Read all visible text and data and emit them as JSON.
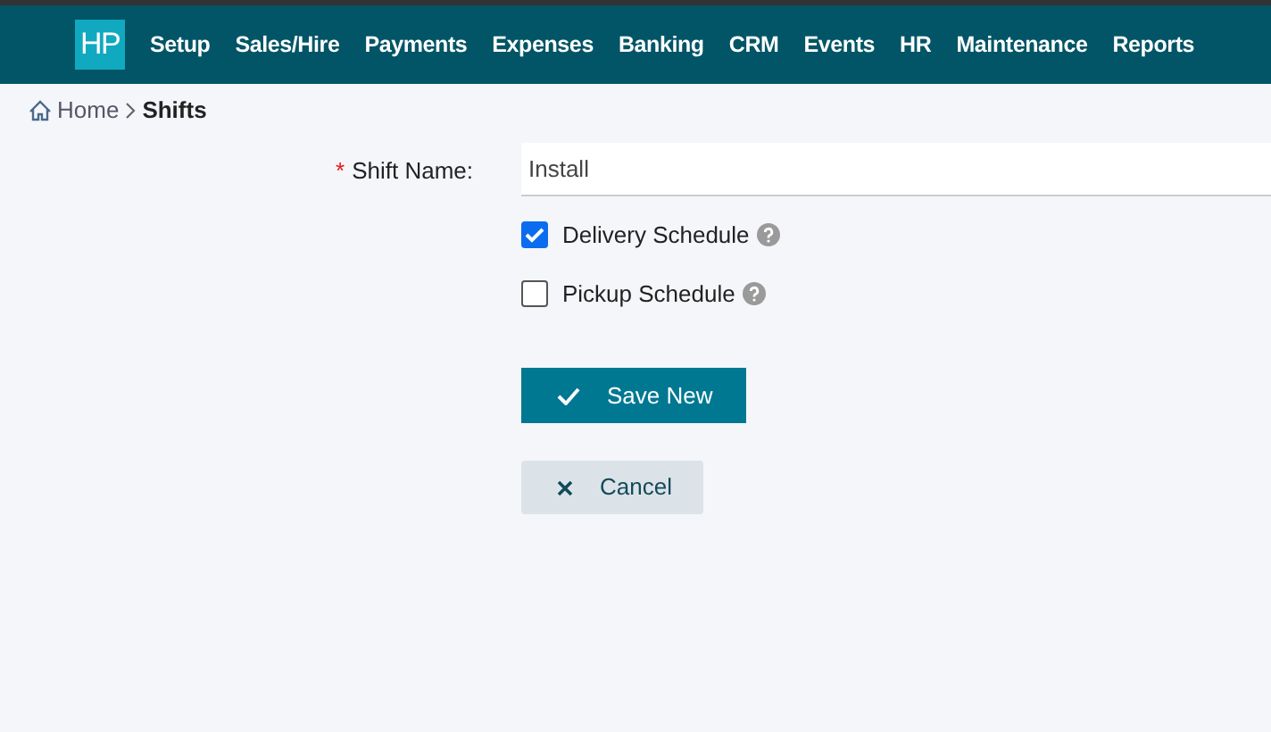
{
  "logo": {
    "text": "HP"
  },
  "nav": [
    "Setup",
    "Sales/Hire",
    "Payments",
    "Expenses",
    "Banking",
    "CRM",
    "Events",
    "HR",
    "Maintenance",
    "Reports"
  ],
  "breadcrumb": [
    {
      "label": "Home",
      "current": false
    },
    {
      "label": "Shifts",
      "current": true
    }
  ],
  "form": {
    "shift_name": {
      "label": "Shift Name:",
      "required_mark": "*",
      "value": "Install"
    },
    "checkboxes": [
      {
        "label": "Delivery Schedule",
        "checked": true
      },
      {
        "label": "Pickup Schedule",
        "checked": false
      }
    ]
  },
  "buttons": [
    {
      "kind": "primary",
      "label": "Save New"
    },
    {
      "kind": "secondary",
      "label": "Cancel"
    }
  ]
}
